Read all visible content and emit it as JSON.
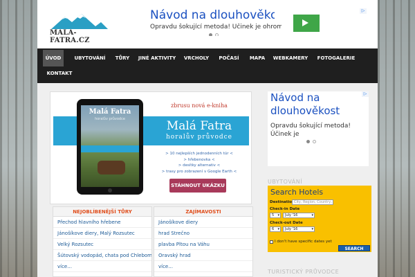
{
  "logo": {
    "text": "MALA-FATRA.CZ"
  },
  "top_ad": {
    "title": "Návod na dlouhověkost",
    "description": "Opravdu šokující metoda! Účinek je ohromující"
  },
  "nav": {
    "items": [
      {
        "label": "ÚVOD",
        "active": true
      },
      {
        "label": "UBYTOVÁNÍ"
      },
      {
        "label": "TŮRY"
      },
      {
        "label": "JINÉ AKTIVITY"
      },
      {
        "label": "VRCHOLY"
      },
      {
        "label": "POČASÍ"
      },
      {
        "label": "MAPA"
      },
      {
        "label": "WEBKAMERY"
      },
      {
        "label": "FOTOGALERIE"
      },
      {
        "label": "KONTAKT"
      }
    ]
  },
  "promo": {
    "kicker": "zbrusu nová e-kniha",
    "title": "Malá Fatra",
    "subtitle": "horalův průvodce",
    "bullets": [
      "> 10 nejlepších jednodenních túr <",
      "> hřebenovka <",
      "> desítky alternativ <",
      "> trasy pro zobrazení v Google Earth <"
    ],
    "button": "STÁHNOUT UKÁZKU",
    "tablet": {
      "title": "Malá Fatra",
      "subtitle": "horalův průvodce"
    }
  },
  "popular_trips": {
    "heading": "NEJOBLÍBENĚJŠÍ TŮRY",
    "items": [
      "Přechod hlavního hřebene",
      "Jánošíkove diery, Malý Rozsutec",
      "Velký Rozsutec",
      "Šútovský vodopád, chata pod Chlebom",
      "více..."
    ]
  },
  "attractions": {
    "heading": "ZAJÍMAVOSTI",
    "items": [
      "Jánošíkove diery",
      "hrad Strečno",
      "plavba Pltou na Váhu",
      "Oravský hrad",
      "více..."
    ]
  },
  "sidebar_ad": {
    "title": "Návod na dlouhověkost",
    "description": "Opravdu šokující metoda! Účinek je"
  },
  "sidebar": {
    "accommodation_heading": "UBYTOVÁNÍ",
    "guide_heading": "TURISTICKÝ PRŮVODCE"
  },
  "hotel_search": {
    "title": "Search Hotels",
    "destination_label": "Destination",
    "destination_placeholder": "City, Region, Country...",
    "checkin_label": "Check-in Date",
    "checkin_day": "5",
    "checkin_month": "July '16",
    "checkout_label": "Check-out Date",
    "checkout_day": "6",
    "checkout_month": "July '16",
    "no_dates_label": "I don't have specific dates yet",
    "search_button": "SEARCH"
  },
  "colors": {
    "nav_bg": "#1f1f1f",
    "accent_orange": "#e04e1c",
    "link_blue": "#1c5a96",
    "promo_blue": "#2aa4d4",
    "hotel_yellow": "#f9c000"
  }
}
